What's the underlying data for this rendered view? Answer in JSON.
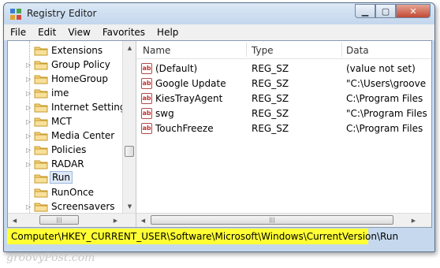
{
  "window": {
    "title": "Registry Editor"
  },
  "menu": [
    "File",
    "Edit",
    "View",
    "Favorites",
    "Help"
  ],
  "tree": {
    "items": [
      {
        "label": "Extensions",
        "expandable": false,
        "selected": false
      },
      {
        "label": "Group Policy",
        "expandable": true,
        "selected": false
      },
      {
        "label": "HomeGroup",
        "expandable": true,
        "selected": false
      },
      {
        "label": "ime",
        "expandable": true,
        "selected": false
      },
      {
        "label": "Internet Settings",
        "expandable": true,
        "selected": false
      },
      {
        "label": "MCT",
        "expandable": true,
        "selected": false
      },
      {
        "label": "Media Center",
        "expandable": true,
        "selected": false
      },
      {
        "label": "Policies",
        "expandable": true,
        "selected": false
      },
      {
        "label": "RADAR",
        "expandable": true,
        "selected": false
      },
      {
        "label": "Run",
        "expandable": false,
        "selected": true
      },
      {
        "label": "RunOnce",
        "expandable": false,
        "selected": false
      },
      {
        "label": "Screensavers",
        "expandable": true,
        "selected": false
      }
    ]
  },
  "list": {
    "columns": [
      "Name",
      "Type",
      "Data"
    ],
    "rows": [
      {
        "name": "(Default)",
        "type": "REG_SZ",
        "data": "(value not set)"
      },
      {
        "name": "Google Update",
        "type": "REG_SZ",
        "data": "\"C:\\Users\\groove"
      },
      {
        "name": "KiesTrayAgent",
        "type": "REG_SZ",
        "data": "C:\\Program Files"
      },
      {
        "name": "swg",
        "type": "REG_SZ",
        "data": "\"C:\\Program Files"
      },
      {
        "name": "TouchFreeze",
        "type": "REG_SZ",
        "data": "C:\\Program Files"
      }
    ]
  },
  "statusbar": {
    "path": "Computer\\HKEY_CURRENT_USER\\Software\\Microsoft\\Windows\\CurrentVersion\\Run"
  },
  "watermark": "groovyPost.com",
  "icons": {
    "app": "registry-icon",
    "folder": "folder-icon",
    "value": "string-value-icon"
  },
  "colors": {
    "status_highlight": "#ffff33",
    "selection": "#dfe9f6",
    "close_button": "#c24a34"
  }
}
